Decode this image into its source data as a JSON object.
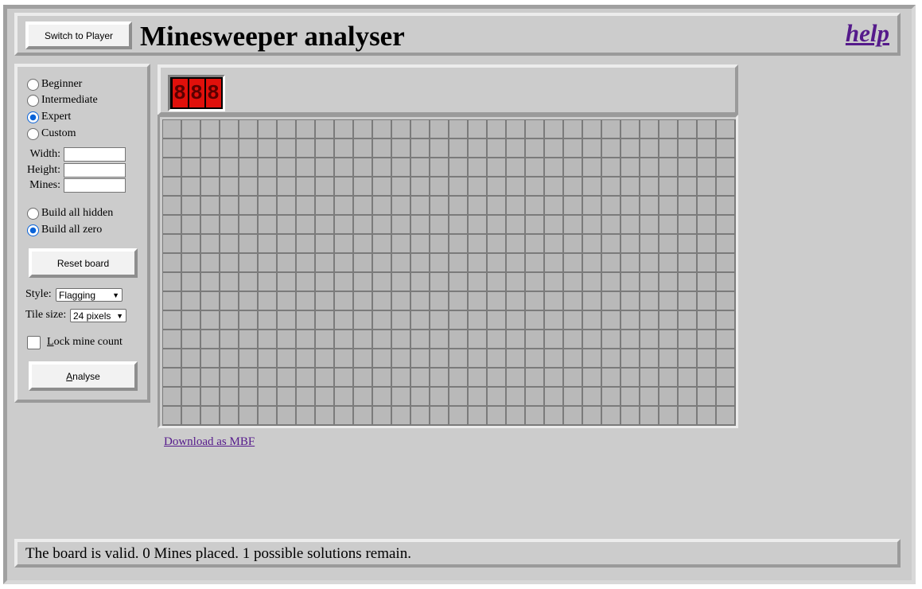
{
  "header": {
    "switch_button": "Switch to Player",
    "title": "Minesweeper analyser",
    "help_link": "help"
  },
  "difficulty": {
    "options": [
      {
        "label": "Beginner",
        "selected": false
      },
      {
        "label": "Intermediate",
        "selected": false
      },
      {
        "label": "Expert",
        "selected": true
      },
      {
        "label": "Custom",
        "selected": false
      }
    ]
  },
  "custom_fields": {
    "width_label": "Width:",
    "height_label": "Height:",
    "mines_label": "Mines:",
    "width_value": "",
    "height_value": "",
    "mines_value": ""
  },
  "build_mode": {
    "options": [
      {
        "label": "Build all hidden",
        "selected": false
      },
      {
        "label": "Build all zero",
        "selected": true
      }
    ]
  },
  "reset_button": "Reset board",
  "style": {
    "label": "Style:",
    "selected": "Flagging"
  },
  "tile_size": {
    "label": "Tile size:",
    "selected": "24 pixels"
  },
  "lock_mine_count": {
    "label_accesskey": "L",
    "label_rest": "ock mine count",
    "checked": false
  },
  "analyse_button": {
    "accesskey": "A",
    "rest": "nalyse"
  },
  "mine_counter": {
    "digits": [
      "8",
      "8",
      "8"
    ]
  },
  "board": {
    "columns": 30,
    "rows": 16
  },
  "download_link": "Download as MBF",
  "status_text": "The board is valid. 0 Mines placed. 1 possible solutions remain.",
  "colors": {
    "counter_red": "#e0100b",
    "link_purple": "#551a8b",
    "radio_blue": "#0a63d8"
  }
}
